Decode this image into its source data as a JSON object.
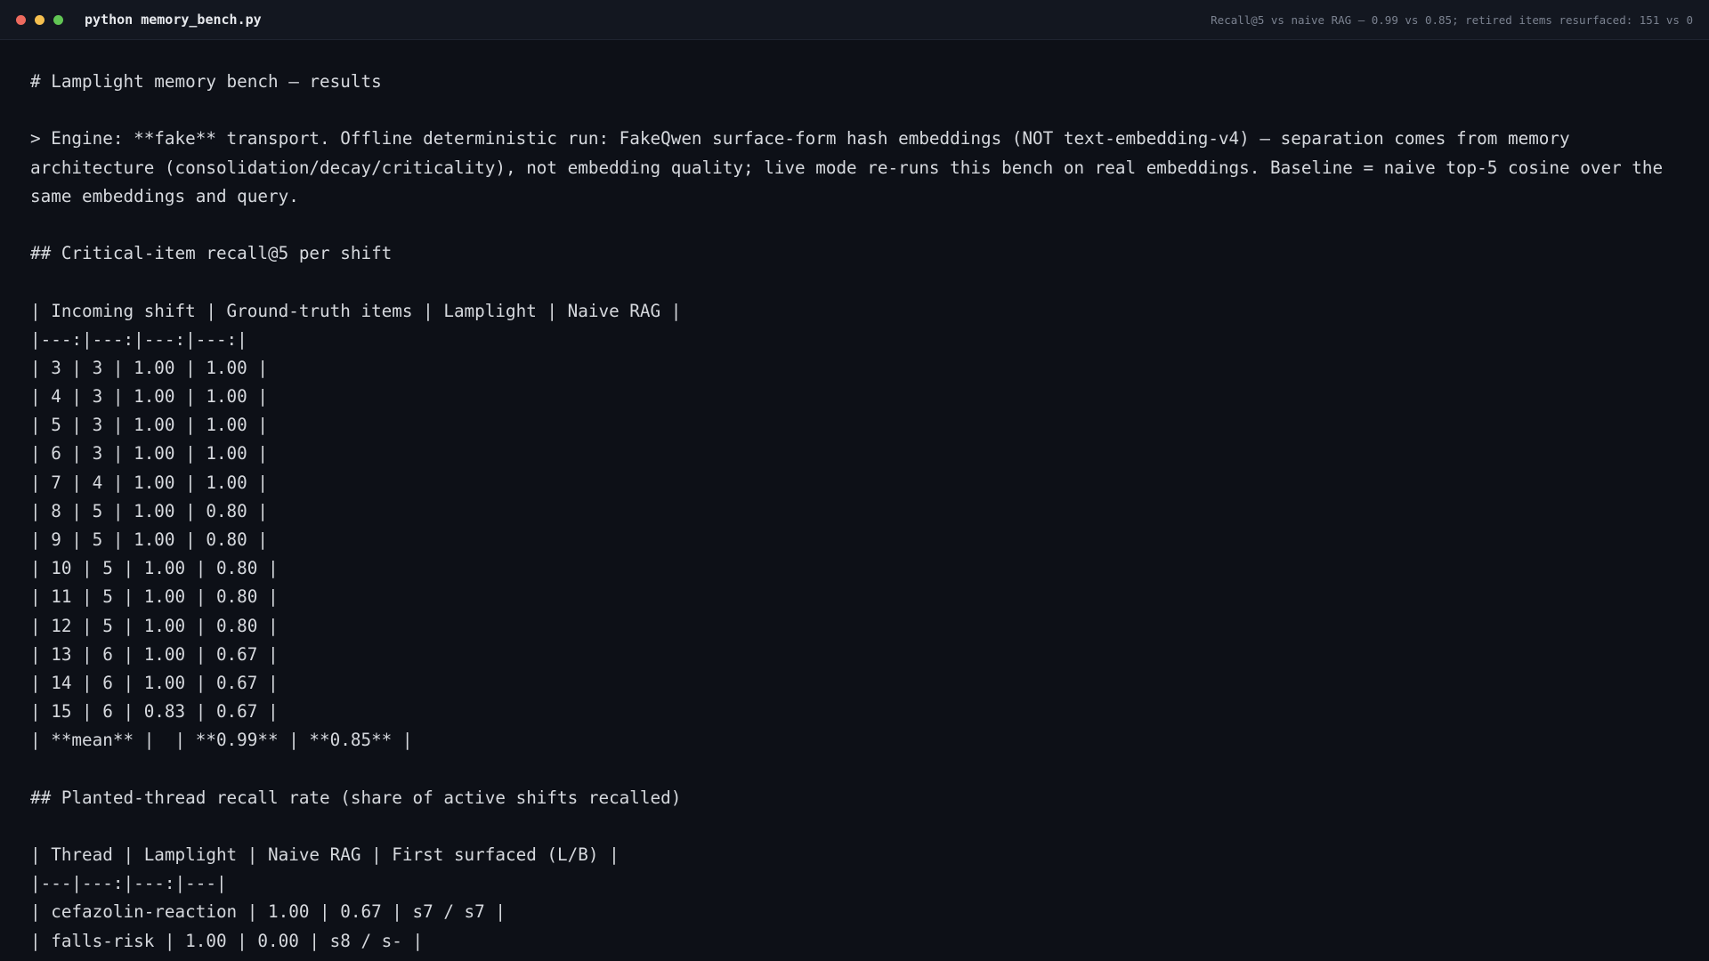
{
  "window": {
    "title": "python memory_bench.py",
    "status": "Recall@5 vs naive RAG — 0.99 vs 0.85; retired items resurfaced: 151 vs 0"
  },
  "output": {
    "heading": "# Lamplight memory bench — results",
    "engine_note": "> Engine: **fake** transport. Offline deterministic run: FakeQwen surface-form hash embeddings (NOT text-embedding-v4) — separation comes from memory architecture (consolidation/decay/criticality), not embedding quality; live mode re-runs this bench on real embeddings. Baseline = naive top-5 cosine over the same embeddings and query.",
    "recall_section": {
      "heading": "## Critical-item recall@5 per shift",
      "header": "| Incoming shift | Ground-truth items | Lamplight | Naive RAG |",
      "separator": "|---:|---:|---:|---:|",
      "rows": [
        "| 3 | 3 | 1.00 | 1.00 |",
        "| 4 | 3 | 1.00 | 1.00 |",
        "| 5 | 3 | 1.00 | 1.00 |",
        "| 6 | 3 | 1.00 | 1.00 |",
        "| 7 | 4 | 1.00 | 1.00 |",
        "| 8 | 5 | 1.00 | 0.80 |",
        "| 9 | 5 | 1.00 | 0.80 |",
        "| 10 | 5 | 1.00 | 0.80 |",
        "| 11 | 5 | 1.00 | 0.80 |",
        "| 12 | 5 | 1.00 | 0.80 |",
        "| 13 | 6 | 1.00 | 0.67 |",
        "| 14 | 6 | 1.00 | 0.67 |",
        "| 15 | 6 | 0.83 | 0.67 |"
      ],
      "mean_row": "| **mean** |  | **0.99** | **0.85** |"
    },
    "thread_section": {
      "heading": "## Planted-thread recall rate (share of active shifts recalled)",
      "header": "| Thread | Lamplight | Naive RAG | First surfaced (L/B) |",
      "separator": "|---|---:|---:|---|",
      "rows": [
        "| cefazolin-reaction | 1.00 | 0.67 | s7 / s7 |",
        "| falls-risk | 1.00 | 0.00 | s8 / s- |"
      ]
    }
  }
}
